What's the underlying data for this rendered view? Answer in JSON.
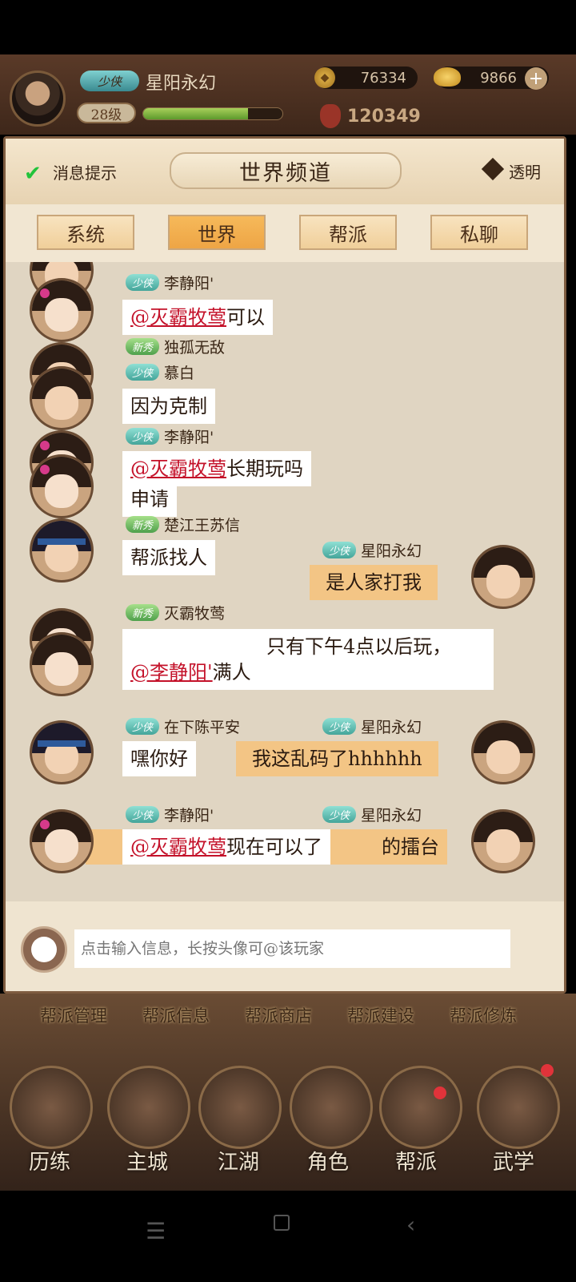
{
  "player": {
    "rank": "少侠",
    "name": "星阳永幻",
    "level": "28级",
    "exp_fraction": 0.75,
    "coins": "76334",
    "ingots": "9866",
    "power": "120349"
  },
  "panel": {
    "title": "世界频道",
    "notify_label": "消息提示",
    "transparent_label": "透明",
    "tabs": [
      "系统",
      "世界",
      "帮派",
      "私聊"
    ],
    "active_tab": "世界"
  },
  "messages": {
    "m1_name": "李静阳'",
    "m1_badge": "少侠",
    "m1_at": "@灭霸牧莺",
    "m1_text": "可以",
    "m2_top_badge": "新秀",
    "m2_top_name": "独孤无敌",
    "m2_badge": "少侠",
    "m2_name": "慕白",
    "m2_text": "因为克制",
    "m3_top_badge": "少侠",
    "m3_top_name": "李静阳'",
    "m3_at": "@灭霸牧莺",
    "m3_text_a": "长期玩吗",
    "m3_text": "申请",
    "m4_badge": "新秀",
    "m4_name": "楚江王苏信",
    "m4_text": "帮派找人",
    "me1_badge": "少侠",
    "me1_name": "星阳永幻",
    "me1_text": "是人家打我",
    "m5_badge": "新秀",
    "m5_name": "灭霸牧莺",
    "m5_text": "只有下午4点以后玩，",
    "m5_at": "@李静阳'",
    "m5_text2": "满人",
    "m6_badge": "少侠",
    "m6_name": "在下陈平安",
    "m6_text": "嘿你好",
    "me2_badge": "少侠",
    "me2_name": "星阳永幻",
    "me2_text": "我这乱码了hhhhhh",
    "m7_badge": "少侠",
    "m7_name": "李静阳'",
    "m7_at": "@灭霸牧莺",
    "m7_text": "现在可以了",
    "me3_badge": "少侠",
    "me3_name": "星阳永幻",
    "me3_text": "的擂台"
  },
  "input": {
    "placeholder": "点击输入信息，长按头像可@该玩家"
  },
  "guild_menu": [
    "帮派管理",
    "帮派信息",
    "帮派商店",
    "帮派建设",
    "帮派修炼"
  ],
  "nav": [
    "历练",
    "主城",
    "江湖",
    "角色",
    "帮派",
    "武学"
  ],
  "colors": {
    "my_bubble": "#f3c585",
    "mention": "#c4122a",
    "active_tab": "#eea545"
  }
}
